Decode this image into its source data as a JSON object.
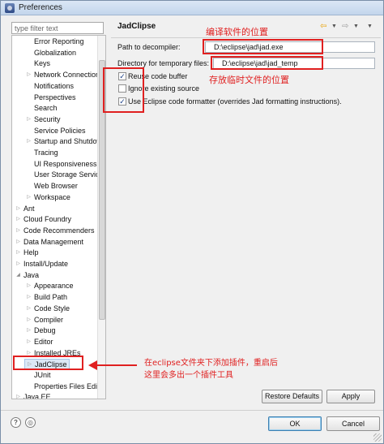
{
  "window": {
    "title": "Preferences"
  },
  "filter": {
    "placeholder": "type filter text"
  },
  "tree": {
    "items": [
      {
        "label": "Error Reporting",
        "level": 2,
        "twisty": ""
      },
      {
        "label": "Globalization",
        "level": 2,
        "twisty": ""
      },
      {
        "label": "Keys",
        "level": 2,
        "twisty": ""
      },
      {
        "label": "Network Connections",
        "level": 2,
        "twisty": "collapsed"
      },
      {
        "label": "Notifications",
        "level": 2,
        "twisty": ""
      },
      {
        "label": "Perspectives",
        "level": 2,
        "twisty": ""
      },
      {
        "label": "Search",
        "level": 2,
        "twisty": ""
      },
      {
        "label": "Security",
        "level": 2,
        "twisty": "collapsed"
      },
      {
        "label": "Service Policies",
        "level": 2,
        "twisty": ""
      },
      {
        "label": "Startup and Shutdown",
        "level": 2,
        "twisty": "collapsed"
      },
      {
        "label": "Tracing",
        "level": 2,
        "twisty": ""
      },
      {
        "label": "UI Responsiveness",
        "level": 2,
        "twisty": ""
      },
      {
        "label": "User Storage Service",
        "level": 2,
        "twisty": ""
      },
      {
        "label": "Web Browser",
        "level": 2,
        "twisty": ""
      },
      {
        "label": "Workspace",
        "level": 2,
        "twisty": "collapsed"
      },
      {
        "label": "Ant",
        "level": 1,
        "twisty": "collapsed"
      },
      {
        "label": "Cloud Foundry",
        "level": 1,
        "twisty": "collapsed"
      },
      {
        "label": "Code Recommenders",
        "level": 1,
        "twisty": "collapsed"
      },
      {
        "label": "Data Management",
        "level": 1,
        "twisty": "collapsed"
      },
      {
        "label": "Help",
        "level": 1,
        "twisty": "collapsed"
      },
      {
        "label": "Install/Update",
        "level": 1,
        "twisty": "collapsed"
      },
      {
        "label": "Java",
        "level": 1,
        "twisty": "expanded"
      },
      {
        "label": "Appearance",
        "level": 2,
        "twisty": "collapsed"
      },
      {
        "label": "Build Path",
        "level": 2,
        "twisty": "collapsed"
      },
      {
        "label": "Code Style",
        "level": 2,
        "twisty": "collapsed"
      },
      {
        "label": "Compiler",
        "level": 2,
        "twisty": "collapsed"
      },
      {
        "label": "Debug",
        "level": 2,
        "twisty": "collapsed"
      },
      {
        "label": "Editor",
        "level": 2,
        "twisty": "collapsed"
      },
      {
        "label": "Installed JREs",
        "level": 2,
        "twisty": "collapsed"
      },
      {
        "label": "JadClipse",
        "level": 2,
        "twisty": "collapsed",
        "selected": true
      },
      {
        "label": "JUnit",
        "level": 2,
        "twisty": ""
      },
      {
        "label": "Properties Files Editor",
        "level": 2,
        "twisty": ""
      },
      {
        "label": "Java EE",
        "level": 1,
        "twisty": "collapsed"
      }
    ]
  },
  "page": {
    "title": "JadClipse",
    "decompiler_label": "Path to decompiler:",
    "decompiler_value": "D:\\eclipse\\jad\\jad.exe",
    "tempdir_label": "Directory for temporary files:",
    "tempdir_value": "D:\\eclipse\\jad\\jad_temp",
    "checkboxes": [
      {
        "label": "Reuse code buffer",
        "checked": true
      },
      {
        "label": "Ignore existing source",
        "checked": false
      },
      {
        "label": "Use Eclipse code formatter (overrides Jad formatting instructions).",
        "checked": true
      }
    ]
  },
  "annotations": {
    "decompiler_note": "编译软件的位置",
    "tempdir_note": "存放临时文件的位置",
    "plugin_note_line1": "在eclipse文件夹下添加插件，重启后",
    "plugin_note_line2": "这里会多出一个插件工具"
  },
  "buttons": {
    "restore_defaults": "Restore Defaults",
    "apply": "Apply",
    "ok": "OK",
    "cancel": "Cancel"
  },
  "icons": {
    "back": "back-arrow-icon",
    "forward": "forward-arrow-icon",
    "help": "help-icon",
    "import_export": "import-export-icon"
  },
  "colors": {
    "annotation": "#e02020",
    "selection": "#dce8f6"
  }
}
